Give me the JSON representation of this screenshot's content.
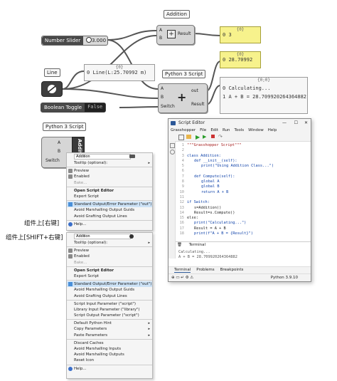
{
  "canvas": {
    "addition_label": "Addition",
    "addition_inputs": [
      "A",
      "B"
    ],
    "addition_output": "Result",
    "slider_name": "Number Slider",
    "slider_value": "3.000",
    "line_label": "Line",
    "line_panel": {
      "header": "{0}",
      "index": "0",
      "text": "Line(L:25.70992 m)"
    },
    "panel_top": {
      "header": "{0}",
      "index": "0",
      "text": "3"
    },
    "panel_mid": {
      "header": "{0}",
      "index": "0",
      "text": "28.70992"
    },
    "panel_out": {
      "header": "{0;0}",
      "rows": [
        {
          "i": "0",
          "t": "Calculating..."
        },
        {
          "i": "1",
          "t": "A + B = 28.709920264364882"
        }
      ]
    },
    "python_label": "Python 3 Script",
    "python_inputs": [
      "A",
      "B",
      "Switch"
    ],
    "python_outputs": [
      "out",
      "Result"
    ],
    "toggle_name": "Boolean Toggle",
    "toggle_value": "False",
    "python2_label": "Python 3 Script",
    "python2_inputs": [
      "A",
      "B",
      "Switch"
    ],
    "python2_output": "out",
    "python2_side": "Addition"
  },
  "annotations": {
    "right_click": "组件上[右键]",
    "shift_right_click": "组件上[SHIFT+右键]"
  },
  "menu1": {
    "name_value": "Addition",
    "items": [
      {
        "label": "Tooltip (optional):",
        "arrow": "▸"
      },
      {
        "label": "Preview",
        "icon": "preview-icon"
      },
      {
        "label": "Enabled",
        "icon": "enabled-icon"
      },
      {
        "label": "Bake...",
        "dis": true
      },
      {
        "label": "Open Script Editor",
        "bold": true
      },
      {
        "label": "Export Script"
      },
      {
        "label": "Standard Output/Error Parameter (\"out\")",
        "checked": true
      },
      {
        "label": "Avoid Marshalling Output Guids"
      },
      {
        "label": "Avoid Grafting Output Lines"
      },
      {
        "label": "Help...",
        "icon": "help-icon"
      }
    ]
  },
  "menu2": {
    "name_value": "Addition",
    "items": [
      {
        "label": "Tooltip (optional):",
        "arrow": "▸"
      },
      {
        "label": "Preview",
        "icon": "preview-icon"
      },
      {
        "label": "Enabled",
        "icon": "enabled-icon"
      },
      {
        "label": "Bake...",
        "dis": true
      },
      {
        "label": "Open Script Editor",
        "bold": true
      },
      {
        "label": "Export Script"
      },
      {
        "label": "Standard Output/Error Parameter (\"out\")",
        "checked": true
      },
      {
        "label": "Avoid Marshalling Output Guids"
      },
      {
        "label": "Avoid Grafting Output Lines"
      },
      {
        "label": "Script Input Parameter (\"script\")"
      },
      {
        "label": "Library Input Parameter (\"library\")"
      },
      {
        "label": "Script Output Parameter (\"script\")"
      },
      {
        "label": "Default Python Hint",
        "arrow": "▸"
      },
      {
        "label": "Copy Parameters",
        "arrow": "▸"
      },
      {
        "label": "Paste Parameters",
        "arrow": "▸"
      },
      {
        "label": "Discard Caches"
      },
      {
        "label": "Avoid Marshalling Inputs"
      },
      {
        "label": "Avoid Marshalling Outputs"
      },
      {
        "label": "Reset Icon"
      },
      {
        "label": "Help...",
        "icon": "help-icon"
      }
    ]
  },
  "editor": {
    "title": "Script Editor",
    "menus": [
      "Grasshopper",
      "File",
      "Edit",
      "Run",
      "Tools",
      "Window",
      "Help"
    ],
    "code": [
      {
        "n": "1",
        "t": "\"\"\"Grasshopper Script\"\"\"",
        "c": "str",
        "ind": 0
      },
      {
        "n": "2",
        "t": "",
        "ind": 0
      },
      {
        "n": "3",
        "t": "class Addition:",
        "ind": 0
      },
      {
        "n": "4",
        "t": "def __init__(self):",
        "ind": 1
      },
      {
        "n": "5",
        "t": "print(\"Using Addition Class...\")",
        "ind": 2
      },
      {
        "n": "6",
        "t": "",
        "ind": 0
      },
      {
        "n": "7",
        "t": "def Compute(self):",
        "ind": 1
      },
      {
        "n": "8",
        "t": "global A",
        "ind": 2
      },
      {
        "n": "9",
        "t": "global B",
        "ind": 2
      },
      {
        "n": "10",
        "t": "return A + B",
        "ind": 2
      },
      {
        "n": "11",
        "t": "",
        "ind": 0
      },
      {
        "n": "12",
        "t": "if Switch:",
        "ind": 0
      },
      {
        "n": "13",
        "t": "s=Addition()",
        "ind": 1
      },
      {
        "n": "14",
        "t": "Result=s.Compute()",
        "ind": 1
      },
      {
        "n": "15",
        "t": "else:",
        "ind": 0
      },
      {
        "n": "16",
        "t": "print(\"Calculating...\")",
        "ind": 1
      },
      {
        "n": "17",
        "t": "Result = A + B",
        "ind": 1
      },
      {
        "n": "18",
        "t": "print(f\"A + B = {Result}\")",
        "ind": 1
      }
    ],
    "terminal_tab": "Terminal",
    "terminal_lines": [
      "Calculating...",
      "A + B = 28.709920264364882"
    ],
    "bottom_tabs": [
      "Terminal",
      "Problems",
      "Breakpoints"
    ],
    "status": "Python 3.9.10"
  }
}
